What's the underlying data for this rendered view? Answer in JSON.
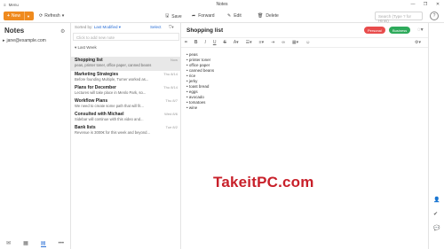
{
  "titlebar": {
    "menu_label": "Menu",
    "title": "Notes",
    "controls": [
      "—",
      "❐",
      "✕"
    ]
  },
  "toolbar": {
    "new_label": "New",
    "refresh_label": "Refresh",
    "save_label": "Save",
    "forward_label": "Forward",
    "edit_label": "Edit",
    "delete_label": "Delete",
    "search_placeholder": "Search (Type ? for Hints)"
  },
  "sidebar": {
    "title": "Notes",
    "account": "jane@example.com"
  },
  "notelist": {
    "sort_label": "Sorted by:",
    "sort_value": "Last Modified ▾",
    "select_label": "Select",
    "add_placeholder": "Click to add new note",
    "group_label": "Last Week",
    "notes": [
      {
        "title": "Shopping list",
        "date": "Now",
        "snippet": "peas, printer toner, office paper, canned beans"
      },
      {
        "title": "Marketing Strategies",
        "date": "Thu 8/14",
        "snippet": "Before founding Multiple, Turner worked as..."
      },
      {
        "title": "Plans for December",
        "date": "Thu 8/14",
        "snippet": "Lectures will take place in Menlo Park, so..."
      },
      {
        "title": "Workflow Plans",
        "date": "Thu 8/7",
        "snippet": "We need to create some path that will fit..."
      },
      {
        "title": "Consulted with Michael",
        "date": "Wed 8/6",
        "snippet": "Sidebar will continue with this video and..."
      },
      {
        "title": "Bank lists",
        "date": "Tue 8/2",
        "snippet": "Revenue is 3000€ for this week and beyond..."
      }
    ]
  },
  "editor": {
    "title": "Shopping list",
    "tags": [
      "Personal",
      "Business"
    ],
    "items": [
      "peas",
      "printer toner",
      "office paper",
      "canned beans",
      "rice",
      "jerky",
      "toast bread",
      "eggs",
      "avocado",
      "tomatoes",
      "wine"
    ]
  },
  "watermark": "TakeitPC.com",
  "colors": {
    "accent": "#ef8a1e",
    "link": "#2a6fd6",
    "tag_personal": "#e84c4c",
    "tag_business": "#2eaa5b",
    "watermark": "#c8202a"
  }
}
